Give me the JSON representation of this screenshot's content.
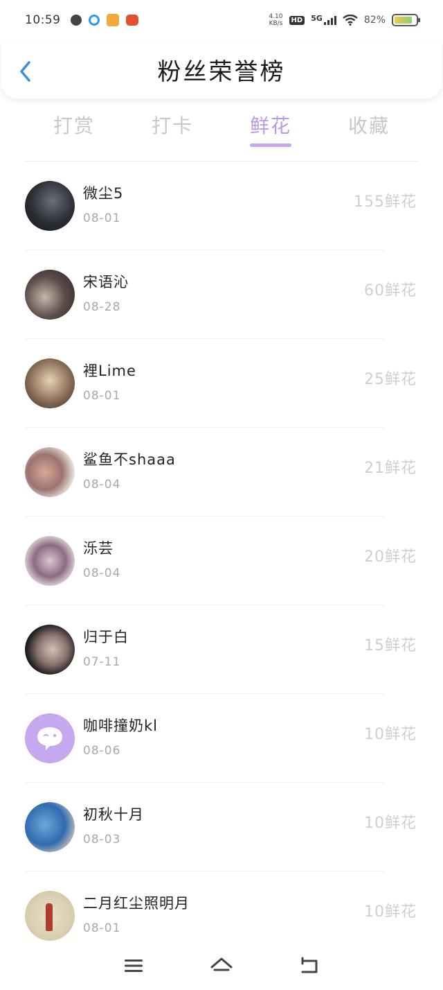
{
  "status_bar": {
    "time": "10:59",
    "net_speed_value": "4.10",
    "net_speed_unit": "KB/s",
    "hd_label": "HD",
    "network_label": "5G",
    "battery_text": "82%"
  },
  "header": {
    "title": "粉丝荣誉榜"
  },
  "tabs": [
    {
      "label": "打赏",
      "active": false
    },
    {
      "label": "打卡",
      "active": false
    },
    {
      "label": "鲜花",
      "active": true
    },
    {
      "label": "收藏",
      "active": false
    }
  ],
  "fans": [
    {
      "name": "微尘5",
      "date": "08-01",
      "flowers": "155鲜花"
    },
    {
      "name": "宋语沁",
      "date": "08-28",
      "flowers": "60鲜花"
    },
    {
      "name": "裡Lime",
      "date": "08-01",
      "flowers": "25鲜花"
    },
    {
      "name": "鲨鱼不shaaa",
      "date": "08-04",
      "flowers": "21鲜花"
    },
    {
      "name": "泺芸",
      "date": "08-04",
      "flowers": "20鲜花"
    },
    {
      "name": "归于白",
      "date": "07-11",
      "flowers": "15鲜花"
    },
    {
      "name": "咖啡撞奶kl",
      "date": "08-06",
      "flowers": "10鲜花"
    },
    {
      "name": "初秋十月",
      "date": "08-03",
      "flowers": "10鲜花"
    },
    {
      "name": "二月红尘照明月",
      "date": "08-01",
      "flowers": "10鲜花"
    }
  ],
  "colors": {
    "accent": "#b89ae0",
    "tab_indicator": "#c7a8ec",
    "inactive_text": "#c8c8c8",
    "back_arrow": "#3b8fe0"
  },
  "battery_level": 0.82,
  "icons": {
    "back": "chevron-left-icon",
    "nav_menu": "menu-icon",
    "nav_home": "home-icon",
    "nav_back": "return-icon"
  }
}
